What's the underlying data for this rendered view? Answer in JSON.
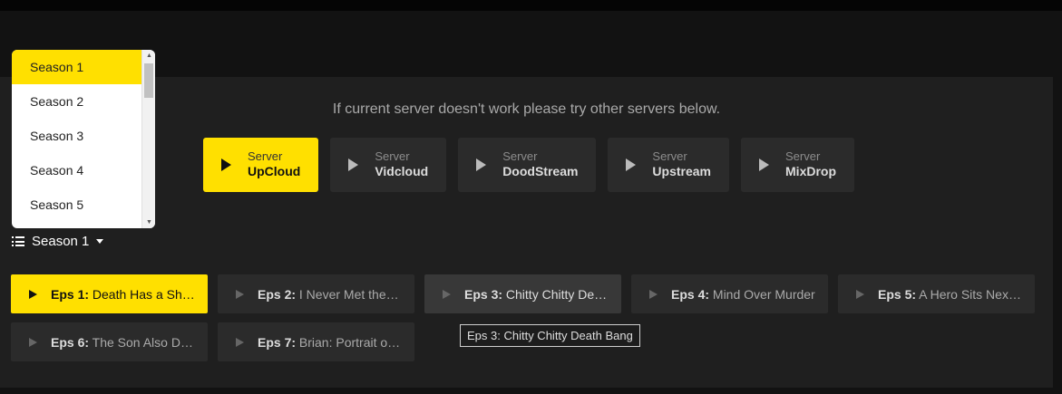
{
  "notice": "If current server doesn't work please try other servers below.",
  "servers": [
    {
      "label": "Server",
      "name": "UpCloud",
      "active": true
    },
    {
      "label": "Server",
      "name": "Vidcloud"
    },
    {
      "label": "Server",
      "name": "DoodStream"
    },
    {
      "label": "Server",
      "name": "Upstream"
    },
    {
      "label": "Server",
      "name": "MixDrop"
    }
  ],
  "season_dropdown": {
    "items": [
      "Season 1",
      "Season 2",
      "Season 3",
      "Season 4",
      "Season 5"
    ],
    "selected": "Season 1"
  },
  "season_button": "Season 1",
  "episodes": [
    {
      "num": "Eps 1:",
      "title": "Death Has a Shadow",
      "active": true
    },
    {
      "num": "Eps 2:",
      "title": "I Never Met the Dead Man"
    },
    {
      "num": "Eps 3:",
      "title": "Chitty Chitty Death Bang",
      "hover": true
    },
    {
      "num": "Eps 4:",
      "title": "Mind Over Murder"
    },
    {
      "num": "Eps 5:",
      "title": "A Hero Sits Next Door"
    },
    {
      "num": "Eps 6:",
      "title": "The Son Also Draws"
    },
    {
      "num": "Eps 7:",
      "title": "Brian: Portrait of a Dog"
    }
  ],
  "tooltip": "Eps 3: Chitty Chitty Death Bang",
  "colors": {
    "accent": "#ffe000",
    "panel": "#1f1f1f",
    "button": "#2b2b2b"
  }
}
